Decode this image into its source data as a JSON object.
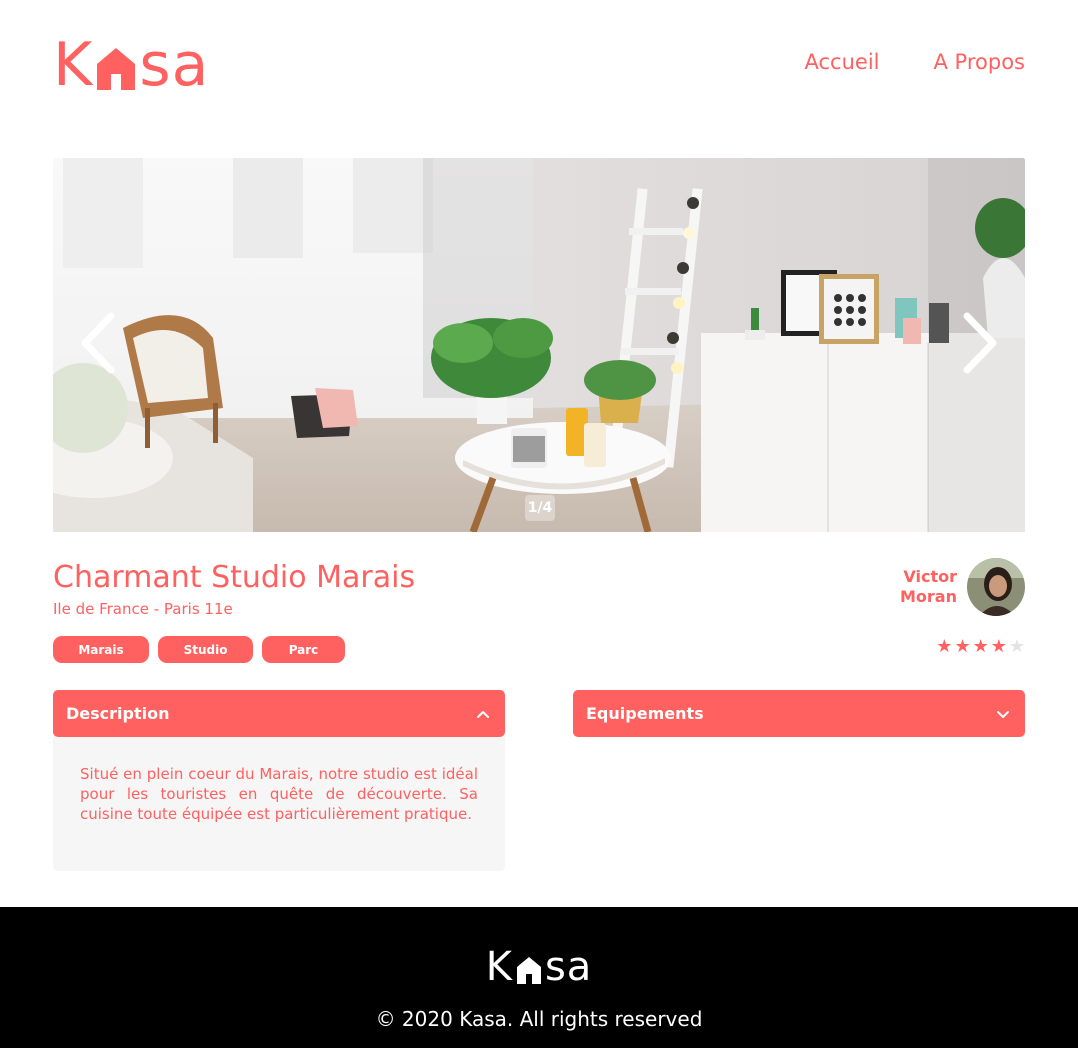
{
  "brand": {
    "logo_left": "K",
    "logo_right": "sa",
    "color": "#FF6060"
  },
  "nav": {
    "home": "Accueil",
    "about": "A Propos"
  },
  "carousel": {
    "counter": "1/4",
    "prev_icon": "chevron-left-icon",
    "next_icon": "chevron-right-icon"
  },
  "listing": {
    "title": "Charmant Studio Marais",
    "location": "Ile de France - Paris 11e",
    "tags": [
      "Marais",
      "Studio",
      "Parc"
    ],
    "host_first": "Victor",
    "host_last": "Moran",
    "rating": 4,
    "rating_max": 5
  },
  "description": {
    "title": "Description",
    "text": "Situé en plein coeur du Marais, notre studio est idéal pour les touristes en quête de découverte. Sa cuisine toute équipée est particulièrement pratique.",
    "expanded": true
  },
  "equipments": {
    "title": "Equipements",
    "expanded": false
  },
  "footer": {
    "logo_left": "K",
    "logo_right": "sa",
    "copyright": "© 2020 Kasa. All rights reserved"
  },
  "colors": {
    "accent": "#FF6060",
    "panel": "#F6F6F6",
    "footer_bg": "#000000",
    "star_off": "#E3E3E3"
  }
}
